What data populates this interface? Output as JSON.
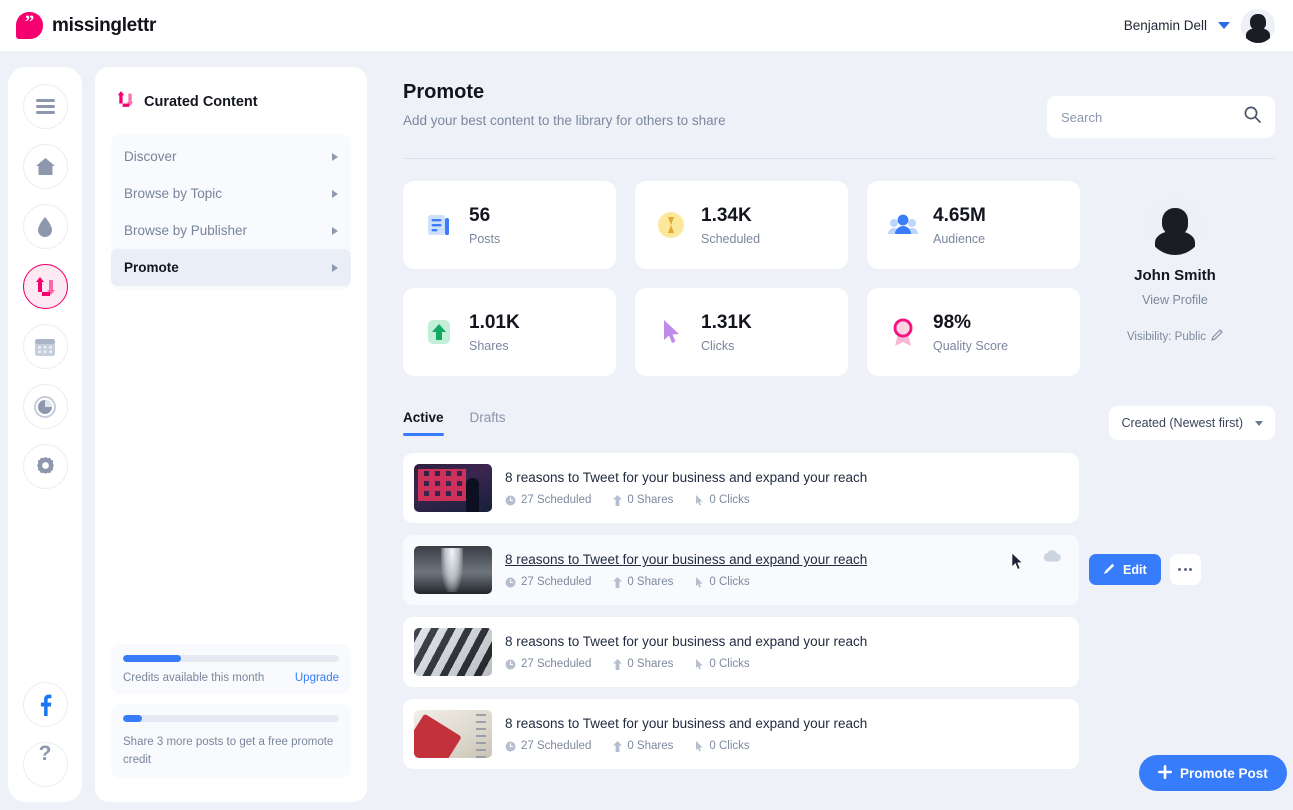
{
  "topbar": {
    "brand_name": "missinglettr",
    "brand_icon": "quote-mark-icon",
    "user_name": "Benjamin Dell",
    "caret_icon": "chevron-down-icon",
    "avatar_icon": "user-avatar"
  },
  "rail": {
    "items": [
      {
        "icon": "hamburger-menu-icon",
        "name": "menu",
        "active": false
      },
      {
        "icon": "home-icon",
        "name": "home",
        "active": false
      },
      {
        "icon": "drop-icon",
        "name": "drip",
        "active": false
      },
      {
        "icon": "retweet-icon",
        "name": "curated-content",
        "active": true
      },
      {
        "icon": "calendar-icon",
        "name": "calendar",
        "active": false
      },
      {
        "icon": "pie-chart-icon",
        "name": "analytics",
        "active": false
      },
      {
        "icon": "gear-icon",
        "name": "settings",
        "active": false
      }
    ],
    "bottom": [
      {
        "icon": "facebook-icon",
        "name": "facebook"
      },
      {
        "icon": "question-mark-icon",
        "name": "help"
      }
    ]
  },
  "panel": {
    "title": "Curated Content",
    "title_icon": "retweet-icon",
    "nav": [
      {
        "label": "Discover",
        "active": false
      },
      {
        "label": "Browse by Topic",
        "active": false
      },
      {
        "label": "Browse by Publisher",
        "active": false
      },
      {
        "label": "Promote",
        "active": true
      }
    ],
    "credits": {
      "label": "Credits available this month",
      "upgrade_label": "Upgrade",
      "progress": 27
    },
    "share_promo": {
      "label": "Share 3 more posts to get a free promote credit",
      "progress": 9
    }
  },
  "header": {
    "title": "Promote",
    "subtitle": "Add your best content to the library for others to share",
    "search_placeholder": "Search",
    "search_value": "",
    "search_icon": "search-icon"
  },
  "stats": [
    {
      "value": "56",
      "label": "Posts",
      "icon": "posts-icon",
      "color": "#3b7df8"
    },
    {
      "value": "1.34K",
      "label": "Scheduled",
      "icon": "hourglass-icon",
      "color": "#f5d14e"
    },
    {
      "value": "4.65M",
      "label": "Audience",
      "icon": "audience-icon",
      "color": "#3b7df8"
    },
    {
      "value": "1.01K",
      "label": "Shares",
      "icon": "up-arrow-icon",
      "color": "#2bbd7e"
    },
    {
      "value": "1.31K",
      "label": "Clicks",
      "icon": "cursor-click-icon",
      "color": "#b87df0"
    },
    {
      "value": "98%",
      "label": "Quality Score",
      "icon": "award-ribbon-icon",
      "color": "#f2157f"
    }
  ],
  "profile": {
    "name": "John Smith",
    "view_profile_label": "View Profile",
    "visibility_label": "Visibility: Public",
    "edit_icon": "pencil-icon",
    "avatar_icon": "user-avatar"
  },
  "tabs": [
    {
      "label": "Active",
      "active": true
    },
    {
      "label": "Drafts",
      "active": false
    }
  ],
  "sort": {
    "selected": "Created (Newest first)",
    "caret_icon": "chevron-down-icon"
  },
  "posts": [
    {
      "title": "8 reasons to Tweet for your business and expand your reach",
      "scheduled": "27 Scheduled",
      "shares": "0 Shares",
      "clicks": "0 Clicks",
      "thumb": "th1",
      "hovered": false
    },
    {
      "title": "8 reasons to Tweet for your business and expand your reach",
      "scheduled": "27 Scheduled",
      "shares": "0 Shares",
      "clicks": "0 Clicks",
      "thumb": "th2",
      "hovered": true
    },
    {
      "title": "8 reasons to Tweet for your business and expand your reach",
      "scheduled": "27 Scheduled",
      "shares": "0 Shares",
      "clicks": "0 Clicks",
      "thumb": "th3",
      "hovered": false
    },
    {
      "title": "8 reasons to Tweet for your business and expand your reach",
      "scheduled": "27 Scheduled",
      "shares": "0 Shares",
      "clicks": "0 Clicks",
      "thumb": "th4",
      "hovered": false
    }
  ],
  "row_actions": {
    "edit_label": "Edit",
    "edit_icon": "pencil-icon",
    "more_icon": "ellipsis-icon"
  },
  "promote_button": {
    "label": "Promote Post",
    "plus_icon": "plus-icon"
  },
  "meta_icons": {
    "scheduled": "clock-icon",
    "shares": "share-arrow-icon",
    "clicks": "cursor-icon"
  },
  "colors": {
    "brand_pink": "#f5006e",
    "accent_blue": "#377dfb",
    "page_bg": "#eef1f8",
    "card_bg": "#ffffff",
    "muted_text": "#7b869c"
  }
}
